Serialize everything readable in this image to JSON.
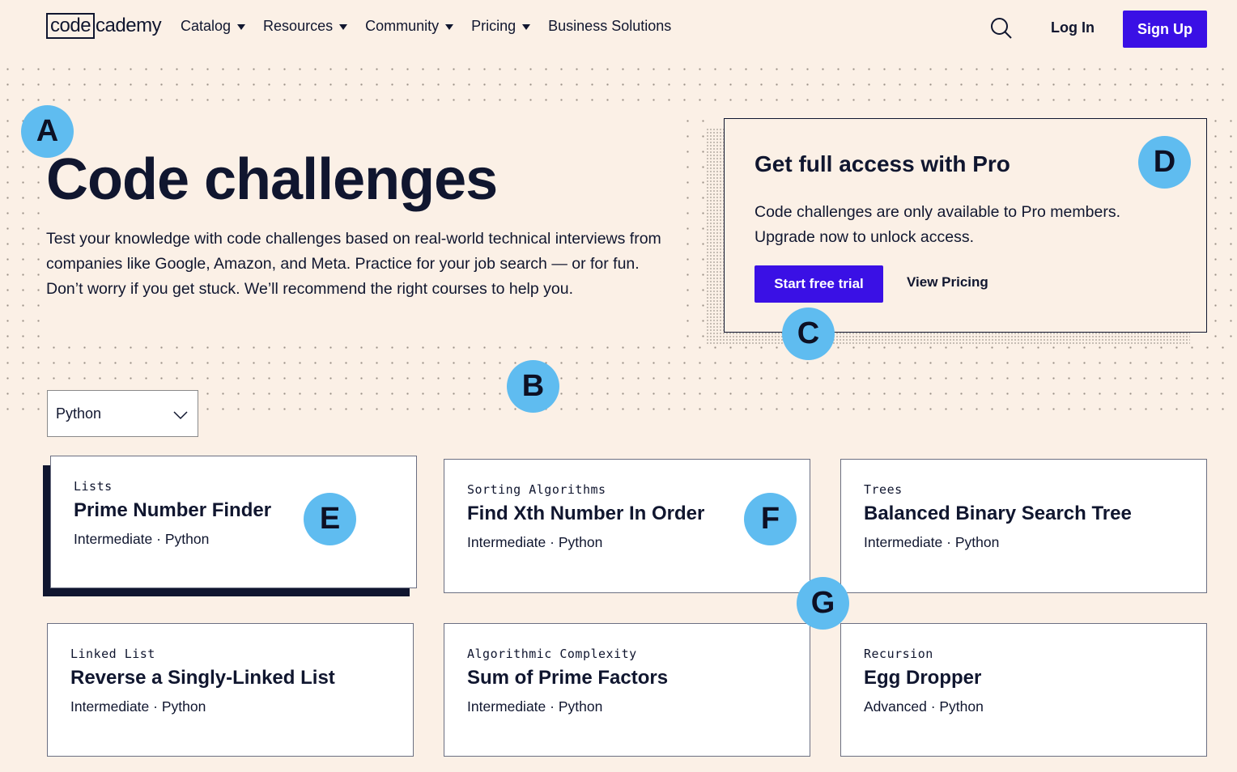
{
  "header": {
    "logo_code": "code",
    "logo_rest": "cademy",
    "nav": [
      {
        "label": "Catalog",
        "dropdown": true
      },
      {
        "label": "Resources",
        "dropdown": true
      },
      {
        "label": "Community",
        "dropdown": true
      },
      {
        "label": "Pricing",
        "dropdown": true
      },
      {
        "label": "Business Solutions",
        "dropdown": false
      }
    ],
    "login_label": "Log In",
    "signup_label": "Sign Up"
  },
  "hero": {
    "title": "Code challenges",
    "description": "Test your knowledge with code challenges based on real-world technical interviews from companies like Google, Amazon, and Meta. Practice for your job search — or for fun. Don’t worry if you get stuck. We’ll recommend the right courses to help you."
  },
  "pro": {
    "title": "Get full access with Pro",
    "text": "Code challenges are only available to Pro members. Upgrade now to unlock access.",
    "trial_label": "Start free trial",
    "pricing_label": "View Pricing"
  },
  "filter": {
    "selected": "Python"
  },
  "challenges": [
    {
      "category": "Lists",
      "name": "Prime Number Finder",
      "meta": "Intermediate · Python"
    },
    {
      "category": "Sorting Algorithms",
      "name": "Find Xth Number In Order",
      "meta": "Intermediate · Python"
    },
    {
      "category": "Trees",
      "name": "Balanced Binary Search Tree",
      "meta": "Intermediate · Python"
    },
    {
      "category": "Linked List",
      "name": "Reverse a Singly-Linked List",
      "meta": "Intermediate · Python"
    },
    {
      "category": "Algorithmic Complexity",
      "name": "Sum of Prime Factors",
      "meta": "Intermediate · Python"
    },
    {
      "category": "Recursion",
      "name": "Egg Dropper",
      "meta": "Advanced · Python"
    }
  ],
  "annotations": [
    "A",
    "B",
    "C",
    "D",
    "E",
    "F",
    "G"
  ],
  "colors": {
    "background": "#fbf0e6",
    "brand": "#3a10e5",
    "ink": "#10162f",
    "badge": "#5fbcf0"
  },
  "icons": {
    "search": "search-icon",
    "caret": "caret-down-icon",
    "chevron": "chevron-down-icon"
  }
}
